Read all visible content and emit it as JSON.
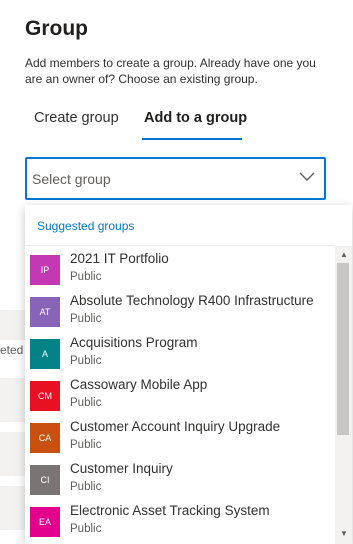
{
  "background": {
    "partial_text": "eted"
  },
  "panel": {
    "title": "Group",
    "description": "Add members to create a group. Already have one you are an owner of? Choose an existing group."
  },
  "tabs": [
    {
      "label": "Create group",
      "selected": false
    },
    {
      "label": "Add to a group",
      "selected": true
    }
  ],
  "select": {
    "placeholder": "Select group"
  },
  "dropdown": {
    "section_label": "Suggested groups",
    "items": [
      {
        "initials": "IP",
        "name": "2021 IT Portfolio",
        "sub": "Public",
        "color": "#c239b3"
      },
      {
        "initials": "AT",
        "name": "Absolute Technology R400 Infrastructure",
        "sub": "Public",
        "color": "#8764b8"
      },
      {
        "initials": "A",
        "name": "Acquisitions Program",
        "sub": "Public",
        "color": "#038387"
      },
      {
        "initials": "CM",
        "name": "Cassowary Mobile App",
        "sub": "Public",
        "color": "#e81123"
      },
      {
        "initials": "CA",
        "name": "Customer Account Inquiry Upgrade",
        "sub": "Public",
        "color": "#ca5010"
      },
      {
        "initials": "CI",
        "name": "Customer Inquiry",
        "sub": "Public",
        "color": "#7a7574"
      },
      {
        "initials": "EA",
        "name": "Electronic Asset Tracking System",
        "sub": "Public",
        "color": "#e3008c"
      }
    ]
  },
  "colors": {
    "accent": "#0078d4",
    "text": "#323130",
    "secondary_text": "#605e5c"
  }
}
